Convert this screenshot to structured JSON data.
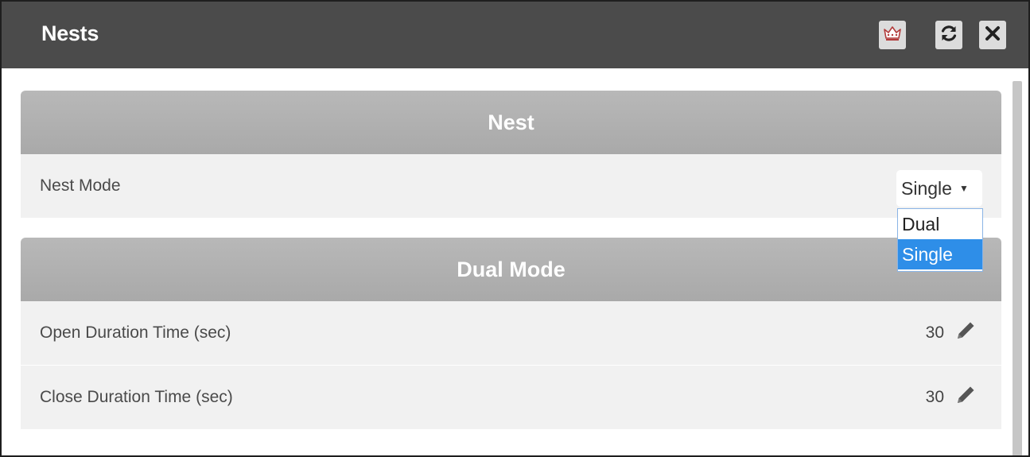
{
  "window": {
    "title": "Nests"
  },
  "toolbar": {
    "buttons": [
      {
        "icon": "crown-icon"
      },
      {
        "icon": "refresh-icon"
      },
      {
        "icon": "close-icon"
      }
    ]
  },
  "nest_section": {
    "header": "Nest",
    "mode_label": "Nest Mode",
    "mode_value": "Single",
    "mode_options": [
      "Dual",
      "Single"
    ],
    "selected_option": "Single"
  },
  "dual_section": {
    "header": "Dual Mode",
    "rows": [
      {
        "label": "Open Duration Time (sec)",
        "value": "30"
      },
      {
        "label": "Close Duration Time (sec)",
        "value": "30"
      }
    ]
  },
  "colors": {
    "titlebar": "#4b4b4b",
    "section_header": "#acacac",
    "row_bg": "#f1f1f1",
    "highlight": "#2e8ee8"
  }
}
